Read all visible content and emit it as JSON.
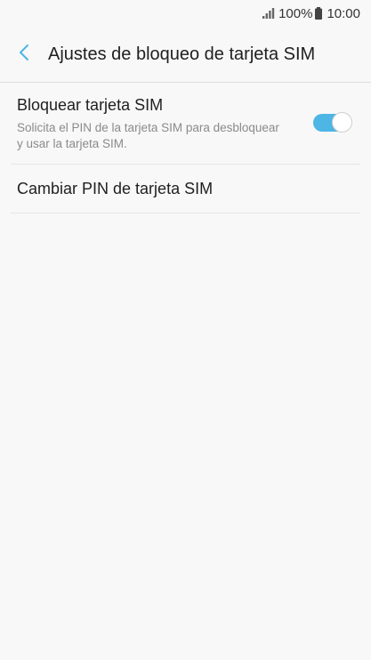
{
  "status_bar": {
    "battery_percent": "100%",
    "time": "10:00",
    "signal_icon": "signal-bars-icon",
    "battery_icon": "battery-icon"
  },
  "app_bar": {
    "back_icon": "chevron-left-icon",
    "title": "Ajustes de bloqueo de tarjeta SIM",
    "accent_color": "#4db6e4"
  },
  "settings": {
    "lock_sim": {
      "title": "Bloquear tarjeta SIM",
      "subtitle": "Solicita el PIN de la tarjeta SIM para desbloquear y usar la tarjeta SIM.",
      "enabled": true
    },
    "change_pin": {
      "title": "Cambiar PIN de tarjeta SIM"
    }
  }
}
